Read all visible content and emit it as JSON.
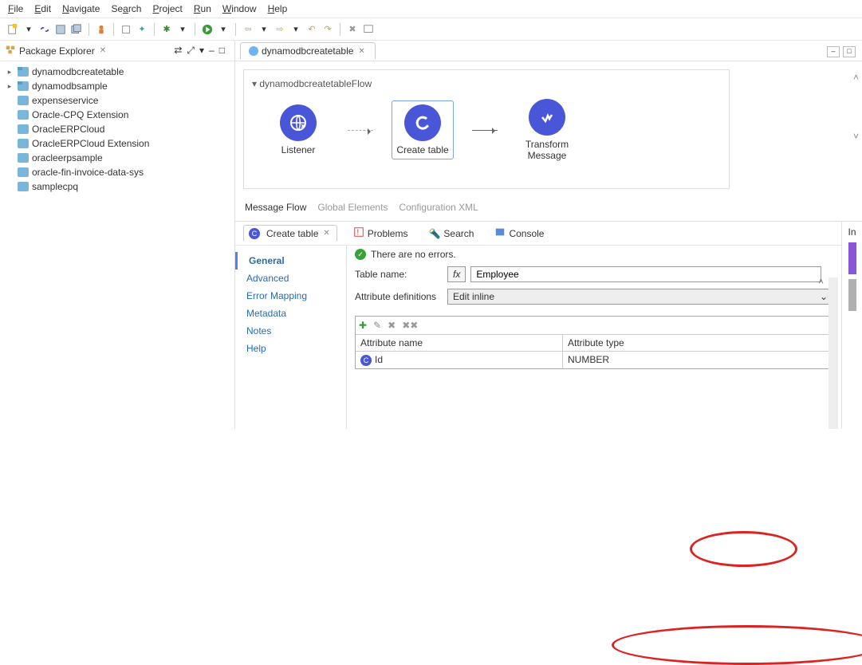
{
  "menu": [
    "File",
    "Edit",
    "Navigate",
    "Search",
    "Project",
    "Run",
    "Window",
    "Help"
  ],
  "package_explorer": {
    "title": "Package Explorer"
  },
  "projects": [
    {
      "name": "dynamodbcreatetable",
      "type": "proj",
      "expandable": true
    },
    {
      "name": "dynamodbsample",
      "type": "proj",
      "expandable": true
    },
    {
      "name": "expenseservice",
      "type": "folder"
    },
    {
      "name": "Oracle-CPQ Extension",
      "type": "folder"
    },
    {
      "name": "OracleERPCloud",
      "type": "folder"
    },
    {
      "name": "OracleERPCloud Extension",
      "type": "folder"
    },
    {
      "name": "oracleerpsample",
      "type": "folder"
    },
    {
      "name": "oracle-fin-invoice-data-sys",
      "type": "folder"
    },
    {
      "name": "samplecpq",
      "type": "folder"
    }
  ],
  "editor_tab": "dynamodbcreatetable",
  "flow_title": "dynamodbcreatetableFlow",
  "nodes": [
    {
      "label": "Listener",
      "icon": "globe"
    },
    {
      "label": "Create table",
      "icon": "c",
      "selected": true
    },
    {
      "label": "Transform Message",
      "icon": "diamond"
    }
  ],
  "canvas_tabs": [
    "Message Flow",
    "Global Elements",
    "Configuration XML"
  ],
  "canvas_tab_active": "Message Flow",
  "bottom_tabs": [
    {
      "label": "Create table",
      "active": true
    },
    {
      "label": "Problems"
    },
    {
      "label": "Search"
    },
    {
      "label": "Console"
    }
  ],
  "status_text": "There are no errors.",
  "side_categories": [
    "General",
    "Advanced",
    "Error Mapping",
    "Metadata",
    "Notes",
    "Help"
  ],
  "side_active": "General",
  "form": {
    "table_name_label": "Table name:",
    "table_name_value": "Employee",
    "fx": "fx",
    "attr_def_label": "Attribute definitions",
    "attr_def_value": "Edit inline"
  },
  "grid": {
    "headers": [
      "Attribute name",
      "Attribute type"
    ],
    "rows": [
      {
        "name": "Id",
        "type": "NUMBER"
      }
    ]
  },
  "far_right_label": "In"
}
